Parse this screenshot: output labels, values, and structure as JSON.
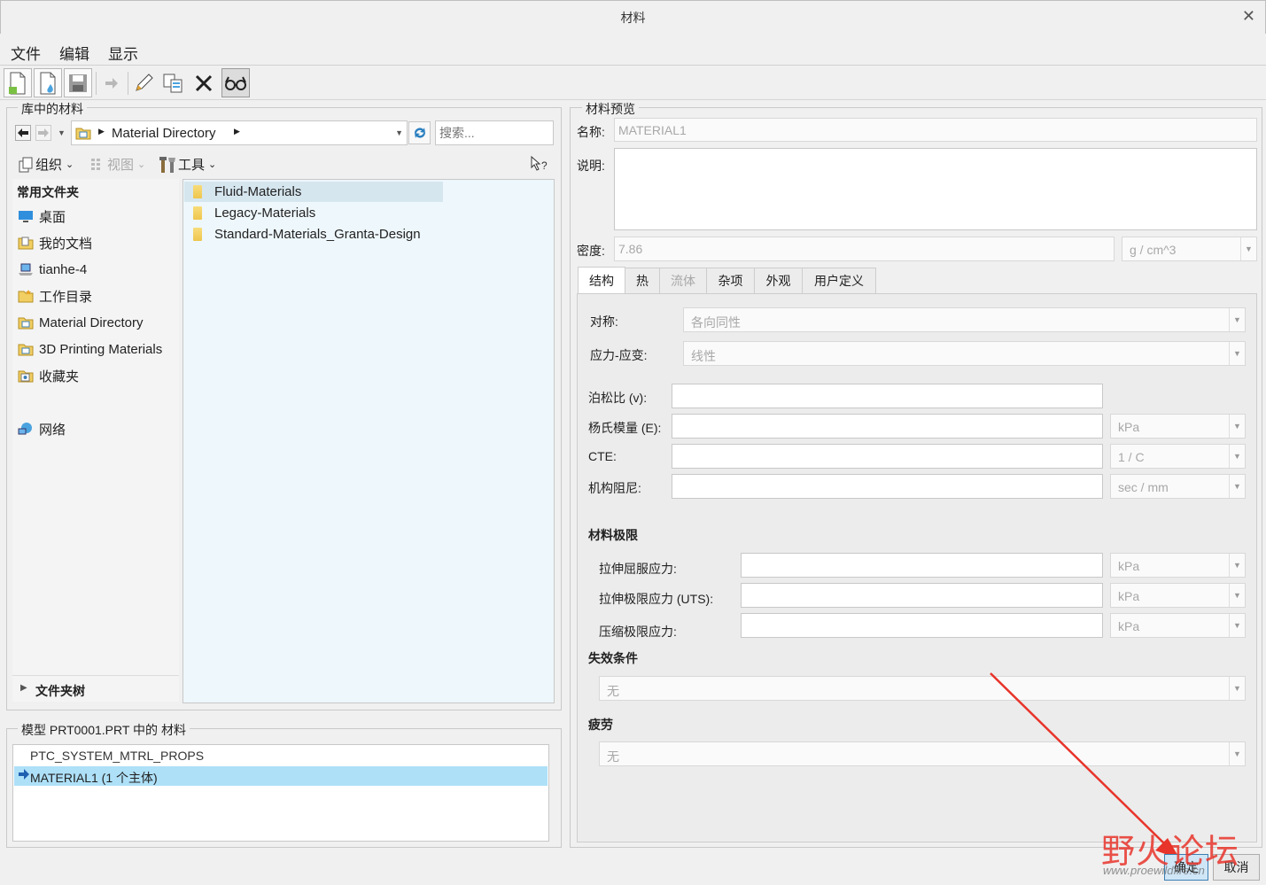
{
  "window": {
    "title": "材料"
  },
  "menu": {
    "file": "文件",
    "edit": "编辑",
    "display": "显示"
  },
  "library": {
    "group_label": "库中的材料",
    "path_text": "Material Directory",
    "search_placeholder": "搜索...",
    "organize_label": "组织",
    "view_label": "视图",
    "tools_label": "工具",
    "favorites_header": "常用文件夹",
    "nav_items": [
      "桌面",
      "我的文档",
      "tianhe-4",
      "工作目录",
      "Material Directory",
      "3D Printing Materials",
      "收藏夹",
      "网络"
    ],
    "folder_tree_label": "文件夹树",
    "folders": [
      "Fluid-Materials",
      "Legacy-Materials",
      "Standard-Materials_Granta-Design"
    ]
  },
  "model": {
    "group_label": "模型 PRT0001.PRT 中的 材料",
    "items": [
      "PTC_SYSTEM_MTRL_PROPS",
      "MATERIAL1 (1 个主体)"
    ]
  },
  "preview": {
    "group_label": "材料预览",
    "name_label": "名称:",
    "name_value": "MATERIAL1",
    "desc_label": "说明:",
    "density_label": "密度:",
    "density_value": "7.86",
    "density_unit": "g / cm^3",
    "tabs": [
      "结构",
      "热",
      "流体",
      "杂项",
      "外观",
      "用户定义"
    ],
    "symmetry_label": "对称:",
    "symmetry_value": "各向同性",
    "stress_strain_label": "应力-应变:",
    "stress_strain_value": "线性",
    "poisson_label": "泊松比 (v):",
    "young_label": "杨氏模量 (E):",
    "young_unit": "kPa",
    "cte_label": "CTE:",
    "cte_unit": "1 / C",
    "damping_label": "机构阻尼:",
    "damping_unit": "sec / mm",
    "limits_title": "材料极限",
    "tensile_yield_label": "拉伸屈服应力:",
    "tensile_yield_unit": "kPa",
    "uts_label": "拉伸极限应力 (UTS):",
    "uts_unit": "kPa",
    "compressive_label": "压缩极限应力:",
    "compressive_unit": "kPa",
    "failure_title": "失效条件",
    "failure_value": "无",
    "fatigue_title": "疲劳",
    "fatigue_value": "无"
  },
  "buttons": {
    "ok": "确定",
    "cancel": "取消"
  },
  "watermark": {
    "text": "野火论坛",
    "url": "www.proewildfire.cn"
  },
  "colors": {
    "selected_row": "#aee0f8",
    "pane_bg": "#eef7fb",
    "arrow": "#e8342a"
  }
}
